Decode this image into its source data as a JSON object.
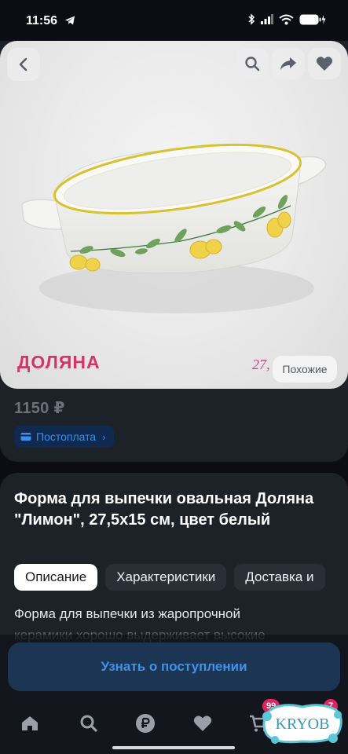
{
  "status_bar": {
    "time": "11:56"
  },
  "product": {
    "brand_logo": "ДОЛЯНА",
    "size_overlay": "27,",
    "similar_button": "Похожие",
    "price": "1150 ₽",
    "postpay_label": "Постоплата",
    "title": "Форма для выпечки овальная Доляна \"Лимон\", 27,5х15 см, цвет белый",
    "tabs": [
      "Описание",
      "Характеристики",
      "Доставка и"
    ],
    "active_tab": "Описание",
    "description_line1": "Форма для выпечки из жаропрочной",
    "description_line2": "керамики хорошо выдерживает высокие"
  },
  "actions": {
    "notify_button": "Узнать о поступлении"
  },
  "bottom_nav": {
    "items": [
      "home-icon",
      "search-icon",
      "ruble-icon",
      "heart-icon",
      "cart-icon"
    ],
    "cart_badge": "99",
    "profile_badge": "7"
  },
  "watermark": "KRYOB",
  "colors": {
    "accent": "#3f93ef",
    "brand": "#d5336a",
    "badge": "#e0245e",
    "background": "#0b0d12",
    "card": "#1d2128"
  }
}
